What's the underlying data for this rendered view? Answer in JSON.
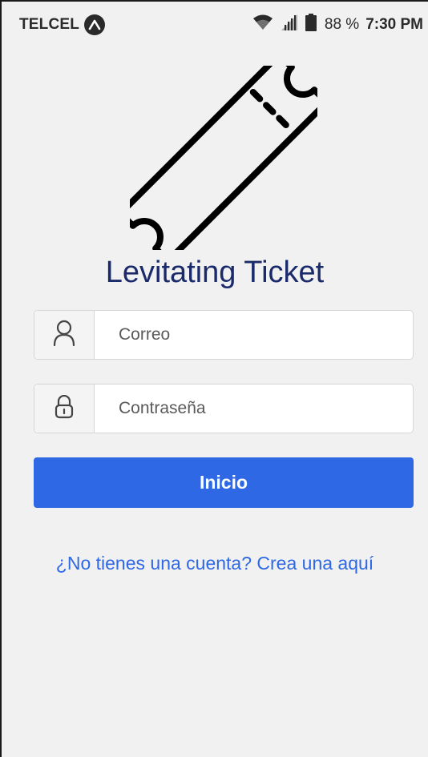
{
  "status_bar": {
    "carrier": "TELCEL",
    "battery_percent": "88 %",
    "time": "7:30 PM"
  },
  "app": {
    "title": "Levitating Ticket"
  },
  "form": {
    "email_placeholder": "Correo",
    "password_placeholder": "Contraseña",
    "email_icon": "user-icon",
    "password_icon": "lock-icon",
    "login_label": "Inicio",
    "signup_text": "¿No tienes una cuenta? Crea una aquí"
  },
  "colors": {
    "background": "#f1f1f1",
    "title": "#1a2a6a",
    "primary": "#2f68e4",
    "button_text": "#ffffff"
  }
}
